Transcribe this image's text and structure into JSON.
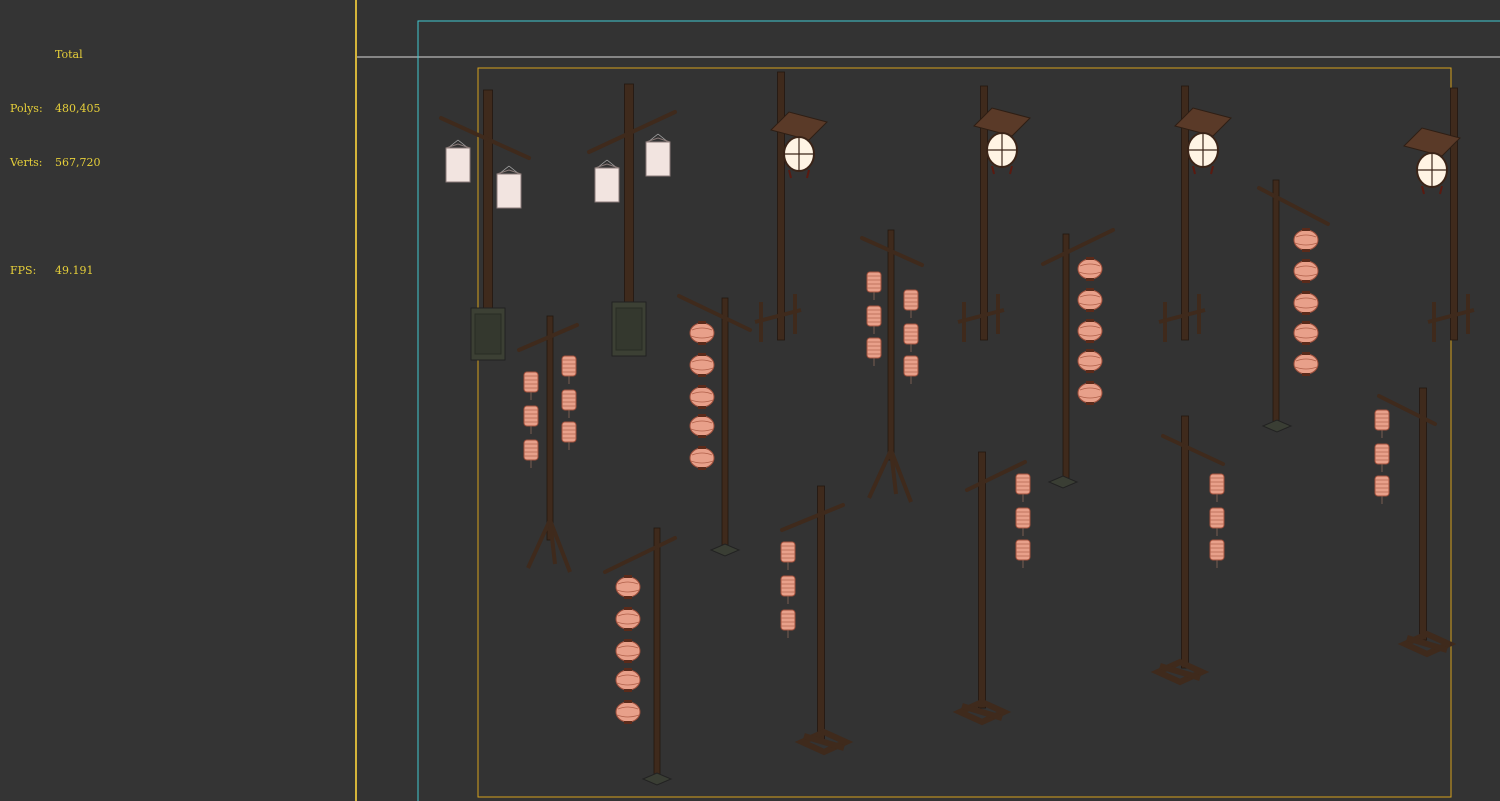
{
  "stats": {
    "header": "Total",
    "polys_label": "Polys:",
    "polys_value": "480,405",
    "verts_label": "Verts:",
    "verts_value": "567,720",
    "fps_label": "FPS:",
    "fps_value": "49.191"
  },
  "colors": {
    "background": "#333333",
    "stats_text": "#e6cf3a",
    "divider": "#d4b43a",
    "safe_frame_outer": "#40c8d0",
    "safe_frame_inner": "#d4a21c",
    "horizon_line": "#d8d8d8",
    "pole_wood": "#3f2a1c",
    "lantern_red": "#e8a08a",
    "lantern_white": "#f2e4e0"
  },
  "scene": {
    "object_type": "lantern-pole",
    "lantern_styles": [
      "square-hanging-lantern",
      "roofed-lantern",
      "round-red-lantern",
      "cylinder-lantern"
    ]
  }
}
